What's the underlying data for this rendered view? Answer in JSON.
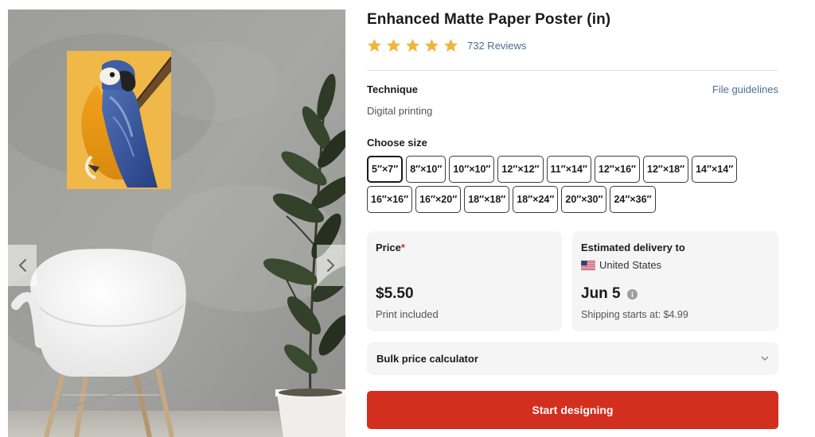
{
  "product": {
    "title": "Enhanced Matte Paper Poster (in)",
    "rating_stars": 5,
    "reviews_label": "732 Reviews"
  },
  "technique": {
    "label": "Technique",
    "value": "Digital printing",
    "guidelines_link": "File guidelines"
  },
  "size": {
    "label": "Choose size",
    "selected": "5″×7″",
    "options": [
      "5″×7″",
      "8″×10″",
      "10″×10″",
      "12″×12″",
      "11″×14″",
      "12″×16″",
      "12″×18″",
      "14″×14″",
      "16″×16″",
      "16″×20″",
      "18″×18″",
      "18″×24″",
      "20″×30″",
      "24″×36″"
    ]
  },
  "price": {
    "label": "Price",
    "required_mark": "*",
    "value": "$5.50",
    "note": "Print included"
  },
  "delivery": {
    "label": "Estimated delivery to",
    "country": "United States",
    "date": "Jun 5",
    "shipping_note": "Shipping starts at: $4.99"
  },
  "bulk": {
    "label": "Bulk price calculator"
  },
  "cta": {
    "label": "Start designing"
  },
  "colors": {
    "accent_red": "#d32f1f",
    "star_gold": "#f2b53a",
    "link_blue": "#4f6d8c"
  },
  "icons": {
    "gallery_prev": "chevron-left-icon",
    "gallery_next": "chevron-right-icon",
    "info": "info-icon",
    "bulk_toggle": "chevron-down-icon",
    "flag": "us-flag-icon"
  }
}
